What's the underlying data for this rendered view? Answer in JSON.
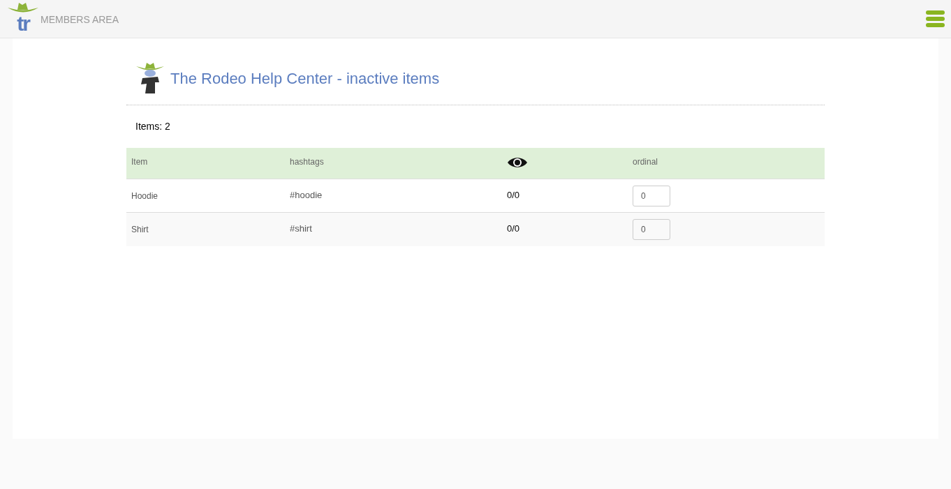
{
  "header": {
    "logo_text": "tr",
    "title": "MEMBERS AREA"
  },
  "page": {
    "title": "The Rodeo Help Center - inactive items",
    "count": "Items: 2"
  },
  "table": {
    "columns": [
      {
        "kind": "text",
        "label": "Item"
      },
      {
        "kind": "text",
        "label": "hashtags"
      },
      {
        "kind": "icon"
      },
      {
        "kind": "text",
        "label": "ordinal"
      }
    ],
    "rows": [
      {
        "item": "Hoodie",
        "hashtag": "#hoodie",
        "views": "0/0",
        "ordinal": "0"
      },
      {
        "item": "Shirt",
        "hashtag": "#shirt",
        "views": "0/0",
        "ordinal": "0"
      }
    ]
  }
}
